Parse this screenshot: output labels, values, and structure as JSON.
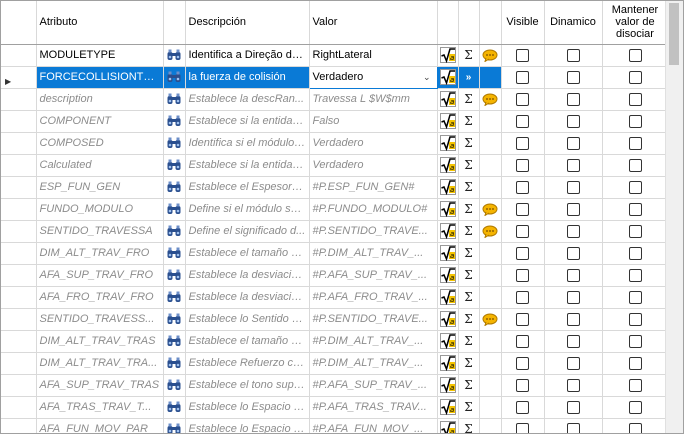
{
  "headers": {
    "atributo": "Atributo",
    "descripcion": "Descripción",
    "valor": "Valor",
    "visible": "Visible",
    "dinamico": "Dinamico",
    "mantener": "Mantener valor de disociar"
  },
  "rows": [
    {
      "atributo": "MODULETYPE",
      "descripcion": "Identifica a Direção da...",
      "valor": "RightLateral",
      "bubble": true,
      "selected": false,
      "dim": false
    },
    {
      "atributo": "FORCECOLLISIONTE...",
      "descripcion": "la fuerza de colisión",
      "valor": "Verdadero",
      "bubble": false,
      "selected": true,
      "dim": false
    },
    {
      "atributo": "description",
      "descripcion": "Establece la descRan...",
      "valor": "Travessa L $W$mm",
      "bubble": true,
      "selected": false,
      "dim": true
    },
    {
      "atributo": "COMPONENT",
      "descripcion": "Establece si la entidad...",
      "valor": "Falso",
      "bubble": false,
      "selected": false,
      "dim": true
    },
    {
      "atributo": "COMPOSED",
      "descripcion": "Identifica si el módulo t...",
      "valor": "Verdadero",
      "bubble": false,
      "selected": false,
      "dim": true
    },
    {
      "atributo": "Calculated",
      "descripcion": "Establece si la entidad...",
      "valor": "Verdadero",
      "bubble": false,
      "selected": false,
      "dim": true
    },
    {
      "atributo": "ESP_FUN_GEN",
      "descripcion": "Establece el Espesor d...",
      "valor": "#P.ESP_FUN_GEN#",
      "bubble": false,
      "selected": false,
      "dim": true
    },
    {
      "atributo": "FUNDO_MODULO",
      "descripcion": "Define si el módulo ser...",
      "valor": "#P.FUNDO_MODULO#",
      "bubble": true,
      "selected": false,
      "dim": true
    },
    {
      "atributo": "SENTIDO_TRAVESSA",
      "descripcion": "Define el significado d...",
      "valor": "#P.SENTIDO_TRAVE...",
      "bubble": true,
      "selected": false,
      "dim": true
    },
    {
      "atributo": "DIM_ALT_TRAV_FRO",
      "descripcion": "Establece el tamaño d...",
      "valor": "#P.DIM_ALT_TRAV_...",
      "bubble": false,
      "selected": false,
      "dim": true
    },
    {
      "atributo": "AFA_SUP_TRAV_FRO",
      "descripcion": "Establece la desviació...",
      "valor": "#P.AFA_SUP_TRAV_...",
      "bubble": false,
      "selected": false,
      "dim": true
    },
    {
      "atributo": "AFA_FRO_TRAV_FRO",
      "descripcion": "Establece la desviació...",
      "valor": "#P.AFA_FRO_TRAV_...",
      "bubble": false,
      "selected": false,
      "dim": true
    },
    {
      "atributo": "SENTIDO_TRAVESS...",
      "descripcion": "Establece lo Sentido R...",
      "valor": "#P.SENTIDO_TRAVE...",
      "bubble": true,
      "selected": false,
      "dim": true
    },
    {
      "atributo": "DIM_ALT_TRAV_TRAS",
      "descripcion": "Establece el tamaño d...",
      "valor": "#P.DIM_ALT_TRAV_...",
      "bubble": false,
      "selected": false,
      "dim": true
    },
    {
      "atributo": "DIM_ALT_TRAV_TRA...",
      "descripcion": "Establece Refuerzo ca...",
      "valor": "#P.DIM_ALT_TRAV_...",
      "bubble": false,
      "selected": false,
      "dim": true
    },
    {
      "atributo": "AFA_SUP_TRAV_TRAS",
      "descripcion": "Establece el tono supe...",
      "valor": "#P.AFA_SUP_TRAV_...",
      "bubble": false,
      "selected": false,
      "dim": true
    },
    {
      "atributo": "AFA_TRAS_TRAV_T...",
      "descripcion": "Establece lo Espacio d...",
      "valor": "#P.AFA_TRAS_TRAV...",
      "bubble": false,
      "selected": false,
      "dim": true
    },
    {
      "atributo": "AFA_FUN_MOV_PAR",
      "descripcion": "Establece lo Espacio d...",
      "valor": "#P.AFA_FUN_MOV_...",
      "bubble": false,
      "selected": false,
      "dim": true
    }
  ],
  "colors": {
    "selection": "#0a7ad6",
    "dim_text": "#8c8c8c"
  }
}
